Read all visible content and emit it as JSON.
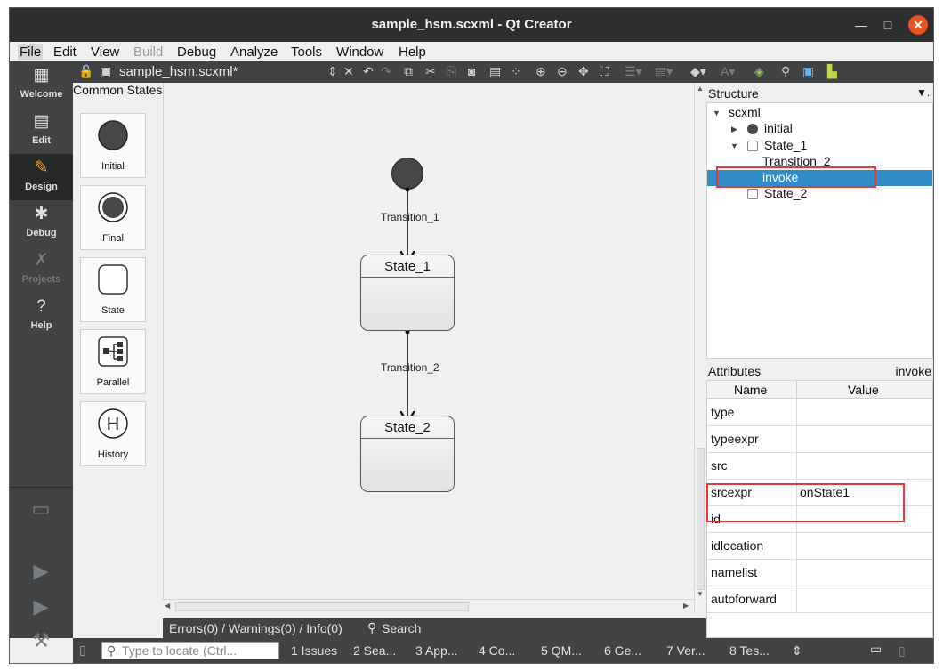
{
  "window": {
    "title": "sample_hsm.scxml - Qt Creator",
    "controls": {
      "minimize": "—",
      "maximize": "□",
      "close": "✕"
    }
  },
  "menu": [
    {
      "label": "File",
      "state": "active"
    },
    {
      "label": "Edit",
      "state": "normal"
    },
    {
      "label": "View",
      "state": "normal"
    },
    {
      "label": "Build",
      "state": "disabled"
    },
    {
      "label": "Debug",
      "state": "normal"
    },
    {
      "label": "Analyze",
      "state": "normal"
    },
    {
      "label": "Tools",
      "state": "normal"
    },
    {
      "label": "Window",
      "state": "normal"
    },
    {
      "label": "Help",
      "state": "normal"
    }
  ],
  "modes": [
    {
      "label": "Welcome",
      "icon": "grid-icon"
    },
    {
      "label": "Edit",
      "icon": "document-icon"
    },
    {
      "label": "Design",
      "icon": "pencil-icon",
      "selected": true
    },
    {
      "label": "Debug",
      "icon": "bug-icon"
    },
    {
      "label": "Projects",
      "icon": "wrench-icon",
      "disabled": true
    },
    {
      "label": "Help",
      "icon": "help-icon"
    }
  ],
  "editor": {
    "filename": "sample_hsm.scxml*"
  },
  "palette": {
    "title": "Common States",
    "items": [
      {
        "label": "Initial",
        "icon": "initial-icon"
      },
      {
        "label": "Final",
        "icon": "final-icon"
      },
      {
        "label": "State",
        "icon": "state-icon"
      },
      {
        "label": "Parallel",
        "icon": "parallel-icon"
      },
      {
        "label": "History",
        "icon": "history-icon",
        "glyph": "H"
      }
    ]
  },
  "diagram": {
    "states": [
      "State_1",
      "State_2"
    ],
    "transitions": [
      "Transition_1",
      "Transition_2"
    ]
  },
  "output_bar": {
    "counts": "Errors(0) / Warnings(0) / Info(0)",
    "search": "Search"
  },
  "structure": {
    "title": "Structure",
    "tree": [
      {
        "label": "scxml",
        "level": 0,
        "marker": "expanded"
      },
      {
        "label": "initial",
        "level": 1,
        "marker": "collapsed",
        "icon": "dot"
      },
      {
        "label": "State_1",
        "level": 1,
        "marker": "expanded",
        "icon": "box"
      },
      {
        "label": "Transition_2",
        "level": 2
      },
      {
        "label": "invoke",
        "level": 2,
        "selected": true
      },
      {
        "label": "State_2",
        "level": 1,
        "icon": "box"
      }
    ]
  },
  "attributes": {
    "title": "Attributes",
    "context": "invoke",
    "columns": [
      "Name",
      "Value"
    ],
    "rows": [
      {
        "name": "type",
        "value": ""
      },
      {
        "name": "typeexpr",
        "value": ""
      },
      {
        "name": "src",
        "value": ""
      },
      {
        "name": "srcexpr",
        "value": "onState1"
      },
      {
        "name": "id",
        "value": ""
      },
      {
        "name": "idlocation",
        "value": ""
      },
      {
        "name": "namelist",
        "value": ""
      },
      {
        "name": "autoforward",
        "value": ""
      }
    ]
  },
  "statusbar": {
    "locator_placeholder": "Type to locate (Ctrl...",
    "panes": [
      "1 Issues",
      "2 Sea...",
      "3 App...",
      "4 Co...",
      "5 QM...",
      "6 Ge...",
      "7 Ver...",
      "8 Tes..."
    ]
  },
  "colors": {
    "selection": "#308cc6",
    "highlight": "#e53935",
    "sidebar": "#404244",
    "titlebar": "#2e2e2e",
    "close_button": "#e95420"
  }
}
